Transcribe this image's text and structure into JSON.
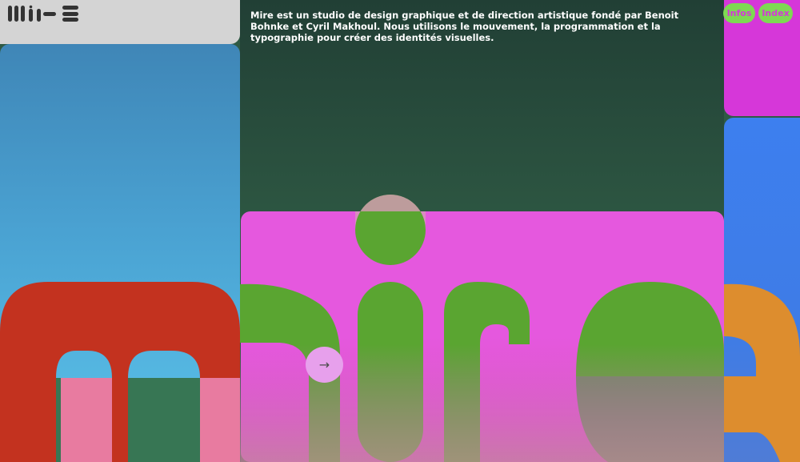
{
  "header": {
    "logo_text": "mire",
    "intro": "Mire est un studio de design graphique et de direction artistique fondé par Benoit Bohnke et Cyril Makhoul. Nous utilisons le mouvement, la programmation et la typographie pour créer des identités visuelles.",
    "nav": [
      {
        "label": "Infos"
      },
      {
        "label": "Index"
      }
    ]
  },
  "hero": {
    "wordmark": "mire",
    "arrow_glyph": "→"
  },
  "colors": {
    "sky": "#4aa2d2",
    "dark_green": "#2f5a44",
    "magenta": "#e558de",
    "green": "#5aa531",
    "red": "#c3321f",
    "pink": "#e87ba0",
    "orange": "#dd8d2e",
    "blue": "#3e7ce6"
  }
}
